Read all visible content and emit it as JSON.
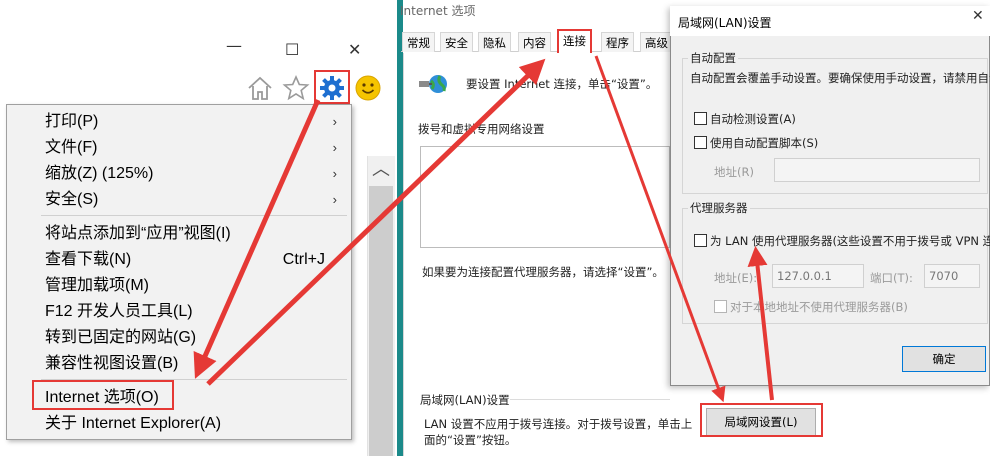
{
  "ie": {
    "win_minimize": "—",
    "win_maximize": "☐",
    "win_close": "✕",
    "scroll_up": "︿"
  },
  "tools_menu": {
    "items": [
      {
        "label": "打印(P)",
        "arrow": "›"
      },
      {
        "label": "文件(F)",
        "arrow": "›"
      },
      {
        "label": "缩放(Z) (125%)",
        "arrow": "›"
      },
      {
        "label": "安全(S)",
        "arrow": "›"
      },
      {
        "label": "将站点添加到“应用”视图(I)"
      },
      {
        "label": "查看下载(N)",
        "shortcut": "Ctrl+J"
      },
      {
        "label": "管理加载项(M)"
      },
      {
        "label": "F12 开发人员工具(L)"
      },
      {
        "label": "转到已固定的网站(G)"
      },
      {
        "label": "兼容性视图设置(B)"
      },
      {
        "label": "Internet 选项(O)"
      },
      {
        "label": "关于 Internet Explorer(A)"
      }
    ]
  },
  "internet_options": {
    "title": "Internet 选项",
    "tabs": [
      "常规",
      "安全",
      "隐私",
      "内容",
      "连接",
      "程序",
      "高级"
    ],
    "active_tab": "连接",
    "setup_text": "要设置 Internet 连接，单击“设置”。",
    "dialup_header": "拨号和虚拟专用网络设置",
    "proxy_hint": "如果要为连接配置代理服务器，请选择“设置”。",
    "lan_header": "局域网(LAN)设置",
    "lan_desc_line1": "LAN 设置不应用于拨号连接。对于拨号设置，单击上",
    "lan_desc_line2": "面的“设置”按钮。",
    "lan_button": "局域网设置(L)"
  },
  "lan_dialog": {
    "title": "局域网(LAN)设置",
    "close": "✕",
    "auto_config_header": "自动配置",
    "auto_config_desc": "自动配置会覆盖手动设置。要确保使用手动设置，请禁用自动",
    "auto_detect": "自动检测设置(A)",
    "use_script": "使用自动配置脚本(S)",
    "address_label": "地址(R)",
    "proxy_header": "代理服务器",
    "use_proxy": "为 LAN 使用代理服务器(这些设置不用于拨号或 VPN 连接",
    "proxy_address_label": "地址(E):",
    "proxy_address": "127.0.0.1",
    "port_label": "端口(T):",
    "port": "7070",
    "bypass_local": "对于本地地址不使用代理服务器(B)",
    "ok_button": "确定"
  },
  "colors": {
    "annotation_red": "#e53935",
    "gear_blue": "#1e6fd0",
    "dialog_accent_teal": "#1b8a8a"
  },
  "icons": [
    "home-icon",
    "favorites-star-icon",
    "tools-gear-icon",
    "feedback-smiley-icon",
    "network-globe-icon"
  ]
}
